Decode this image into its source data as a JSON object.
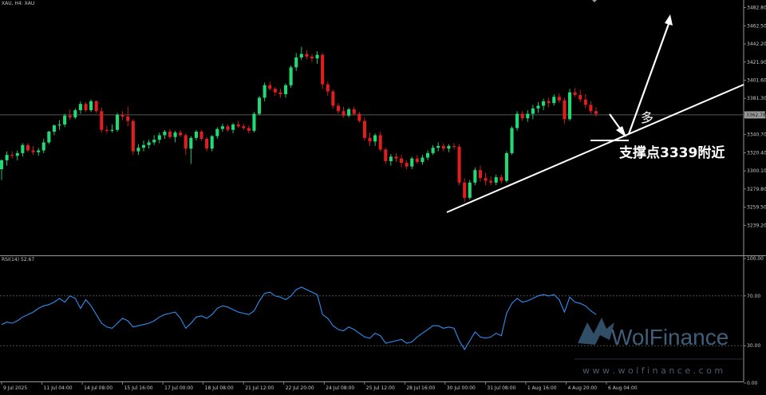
{
  "header": {
    "symbol_label": "XAU, H4: XAU"
  },
  "rsi": {
    "label": "RSI(14) 52.67",
    "levels": [
      30,
      70
    ],
    "axis_ticks": [
      "100.00",
      "70.00",
      "30.00",
      "0.00"
    ]
  },
  "current_price_label": "3362.78",
  "annotations": {
    "bull_label": "多",
    "support_label": "支撑点3339附近"
  },
  "watermark": {
    "brand": "WolFinance",
    "url": "w w w . w o l f i n a n c e . c o m"
  },
  "colors": {
    "background": "#000000",
    "bull": "#21d975",
    "bear": "#e01e1e",
    "rsi_line": "#2f8ef0",
    "grid": "#555555",
    "annotation": "#ffffff",
    "watermark": "#3a5c7a"
  },
  "chart_data": {
    "type": "candlestick",
    "title": "XAU, H4: XAU",
    "y_ticks": [
      3482.8,
      3462.5,
      3442.2,
      3421.9,
      3401.6,
      3381.3,
      3361.0,
      3340.7,
      3320.4,
      3300.1,
      3279.8,
      3259.5,
      3239.2
    ],
    "y_tick_labels": [
      "3482.80",
      "3462.50",
      "3442.20",
      "3421.90",
      "3401.60",
      "3381.30",
      "3361.00",
      "3340.70",
      "3320.40",
      "3300.10",
      "3279.80",
      "3259.50",
      "3239.20"
    ],
    "ylim": [
      3227,
      3486
    ],
    "x_tick_labels": [
      "9 Jul 2025",
      "11 Jul 04:00",
      "14 Jul 08:00",
      "15 Jul 16:00",
      "17 Jul 00:00",
      "18 Jul 08:00",
      "21 Jul 12:00",
      "22 Jul 20:00",
      "24 Jul 08:00",
      "25 Jul 12:00",
      "28 Jul 16:00",
      "30 Jul 00:00",
      "31 Jul 08:00",
      "1 Aug 16:00",
      "4 Aug 20:00",
      "6 Aug 04:00"
    ],
    "candles": [
      [
        3302,
        3313,
        3290,
        3312
      ],
      [
        3312,
        3322,
        3306,
        3318
      ],
      [
        3318,
        3322,
        3314,
        3317
      ],
      [
        3317,
        3323,
        3312,
        3320
      ],
      [
        3320,
        3331,
        3316,
        3329
      ],
      [
        3329,
        3331,
        3321,
        3323
      ],
      [
        3323,
        3328,
        3318,
        3321
      ],
      [
        3321,
        3326,
        3317,
        3323
      ],
      [
        3323,
        3336,
        3320,
        3332
      ],
      [
        3332,
        3345,
        3330,
        3344
      ],
      [
        3344,
        3352,
        3340,
        3351
      ],
      [
        3351,
        3357,
        3346,
        3352
      ],
      [
        3352,
        3364,
        3349,
        3362
      ],
      [
        3362,
        3369,
        3357,
        3360
      ],
      [
        3360,
        3370,
        3358,
        3368
      ],
      [
        3368,
        3378,
        3364,
        3375
      ],
      [
        3375,
        3377,
        3366,
        3368
      ],
      [
        3368,
        3380,
        3366,
        3378
      ],
      [
        3378,
        3379,
        3365,
        3367
      ],
      [
        3367,
        3371,
        3343,
        3346
      ],
      [
        3346,
        3350,
        3342,
        3345
      ],
      [
        3345,
        3352,
        3343,
        3346
      ],
      [
        3346,
        3365,
        3344,
        3363
      ],
      [
        3363,
        3367,
        3357,
        3361
      ],
      [
        3361,
        3372,
        3350,
        3356
      ],
      [
        3356,
        3358,
        3318,
        3322
      ],
      [
        3322,
        3330,
        3318,
        3326
      ],
      [
        3326,
        3334,
        3322,
        3329
      ],
      [
        3329,
        3335,
        3325,
        3332
      ],
      [
        3332,
        3340,
        3329,
        3335
      ],
      [
        3335,
        3343,
        3331,
        3340
      ],
      [
        3340,
        3346,
        3336,
        3344
      ],
      [
        3344,
        3347,
        3336,
        3338
      ],
      [
        3338,
        3345,
        3332,
        3343
      ],
      [
        3343,
        3346,
        3338,
        3340
      ],
      [
        3340,
        3342,
        3318,
        3325
      ],
      [
        3325,
        3339,
        3308,
        3337
      ],
      [
        3337,
        3346,
        3334,
        3344
      ],
      [
        3344,
        3346,
        3334,
        3336
      ],
      [
        3336,
        3338,
        3322,
        3325
      ],
      [
        3325,
        3340,
        3322,
        3339
      ],
      [
        3339,
        3349,
        3336,
        3347
      ],
      [
        3347,
        3353,
        3344,
        3350
      ],
      [
        3350,
        3352,
        3344,
        3346
      ],
      [
        3346,
        3354,
        3342,
        3352
      ],
      [
        3352,
        3356,
        3348,
        3350
      ],
      [
        3350,
        3353,
        3346,
        3348
      ],
      [
        3348,
        3351,
        3342,
        3345
      ],
      [
        3345,
        3366,
        3343,
        3364
      ],
      [
        3364,
        3384,
        3362,
        3382
      ],
      [
        3382,
        3399,
        3378,
        3396
      ],
      [
        3396,
        3400,
        3390,
        3392
      ],
      [
        3392,
        3394,
        3384,
        3388
      ],
      [
        3388,
        3392,
        3382,
        3386
      ],
      [
        3386,
        3398,
        3382,
        3396
      ],
      [
        3396,
        3418,
        3393,
        3416
      ],
      [
        3416,
        3432,
        3412,
        3427
      ],
      [
        3427,
        3439,
        3424,
        3431
      ],
      [
        3431,
        3435,
        3425,
        3428
      ],
      [
        3428,
        3431,
        3422,
        3426
      ],
      [
        3426,
        3434,
        3420,
        3430
      ],
      [
        3430,
        3432,
        3392,
        3397
      ],
      [
        3397,
        3400,
        3384,
        3389
      ],
      [
        3389,
        3391,
        3370,
        3373
      ],
      [
        3373,
        3376,
        3364,
        3367
      ],
      [
        3367,
        3372,
        3360,
        3362
      ],
      [
        3362,
        3371,
        3360,
        3369
      ],
      [
        3369,
        3372,
        3362,
        3364
      ],
      [
        3364,
        3366,
        3354,
        3356
      ],
      [
        3356,
        3360,
        3334,
        3337
      ],
      [
        3337,
        3343,
        3328,
        3333
      ],
      [
        3333,
        3342,
        3328,
        3340
      ],
      [
        3340,
        3344,
        3322,
        3324
      ],
      [
        3324,
        3326,
        3308,
        3311
      ],
      [
        3311,
        3319,
        3306,
        3316
      ],
      [
        3316,
        3320,
        3310,
        3314
      ],
      [
        3314,
        3318,
        3304,
        3309
      ],
      [
        3309,
        3312,
        3302,
        3305
      ],
      [
        3305,
        3316,
        3302,
        3314
      ],
      [
        3314,
        3318,
        3308,
        3310
      ],
      [
        3310,
        3318,
        3307,
        3315
      ],
      [
        3315,
        3323,
        3312,
        3320
      ],
      [
        3320,
        3329,
        3318,
        3326
      ],
      [
        3326,
        3332,
        3322,
        3328
      ],
      [
        3328,
        3331,
        3322,
        3325
      ],
      [
        3325,
        3330,
        3321,
        3328
      ],
      [
        3328,
        3331,
        3324,
        3327
      ],
      [
        3327,
        3330,
        3284,
        3287
      ],
      [
        3287,
        3292,
        3265,
        3270
      ],
      [
        3270,
        3290,
        3268,
        3287
      ],
      [
        3287,
        3304,
        3284,
        3301
      ],
      [
        3301,
        3306,
        3288,
        3292
      ],
      [
        3292,
        3298,
        3284,
        3289
      ],
      [
        3289,
        3294,
        3284,
        3287
      ],
      [
        3287,
        3296,
        3284,
        3293
      ],
      [
        3293,
        3296,
        3286,
        3289
      ],
      [
        3289,
        3322,
        3287,
        3320
      ],
      [
        3320,
        3350,
        3318,
        3348
      ],
      [
        3348,
        3367,
        3345,
        3364
      ],
      [
        3364,
        3367,
        3356,
        3359
      ],
      [
        3359,
        3368,
        3355,
        3364
      ],
      [
        3364,
        3374,
        3358,
        3370
      ],
      [
        3370,
        3377,
        3365,
        3373
      ],
      [
        3373,
        3381,
        3368,
        3378
      ],
      [
        3378,
        3382,
        3371,
        3376
      ],
      [
        3376,
        3386,
        3373,
        3383
      ],
      [
        3383,
        3387,
        3376,
        3379
      ],
      [
        3379,
        3382,
        3353,
        3358
      ],
      [
        3358,
        3392,
        3356,
        3388
      ],
      [
        3388,
        3393,
        3383,
        3385
      ],
      [
        3385,
        3391,
        3377,
        3380
      ],
      [
        3380,
        3386,
        3370,
        3374
      ],
      [
        3374,
        3378,
        3364,
        3367
      ],
      [
        3367,
        3371,
        3361,
        3364
      ]
    ],
    "rsi_values": [
      47,
      49,
      48,
      50,
      53,
      55,
      57,
      60,
      62,
      63,
      65,
      68,
      65,
      70,
      68,
      60,
      67,
      62,
      55,
      48,
      45,
      44,
      48,
      52,
      50,
      45,
      46,
      47,
      48,
      50,
      53,
      55,
      56,
      57,
      52,
      44,
      48,
      53,
      54,
      52,
      55,
      60,
      62,
      61,
      59,
      57,
      56,
      55,
      58,
      66,
      72,
      73,
      70,
      69,
      67,
      70,
      75,
      77,
      75,
      73,
      71,
      55,
      52,
      46,
      43,
      42,
      45,
      43,
      40,
      37,
      36,
      40,
      38,
      32,
      33,
      34,
      35,
      32,
      33,
      37,
      40,
      43,
      46,
      46,
      44,
      45,
      44,
      34,
      27,
      34,
      41,
      37,
      36,
      37,
      40,
      38,
      56,
      64,
      68,
      65,
      66,
      68,
      70,
      71,
      70,
      71,
      67,
      57,
      69,
      65,
      64,
      62,
      58,
      55
    ]
  }
}
